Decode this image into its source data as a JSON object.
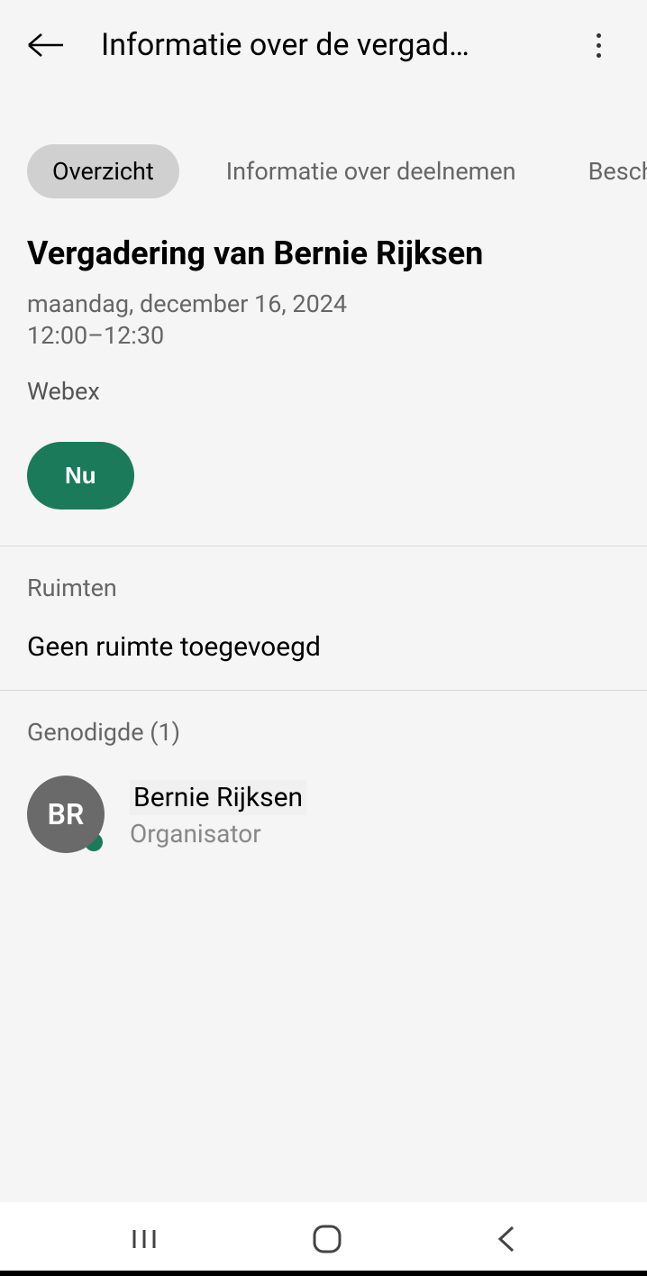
{
  "header": {
    "title": "Informatie over de vergad…"
  },
  "tabs": {
    "overview": "Overzicht",
    "joinInfo": "Informatie over deelnemen",
    "description": "Beschrijvi"
  },
  "meeting": {
    "title": "Vergadering van Bernie Rijksen",
    "date": "maandag, december 16, 2024",
    "time": "12:00–12:30",
    "location": "Webex",
    "nowButton": "Nu"
  },
  "rooms": {
    "label": "Ruimten",
    "value": "Geen ruimte toegevoegd"
  },
  "invitees": {
    "label": "Genodigde (1)",
    "person": {
      "initials": "BR",
      "name": "Bernie Rijksen",
      "role": "Organisator"
    }
  }
}
